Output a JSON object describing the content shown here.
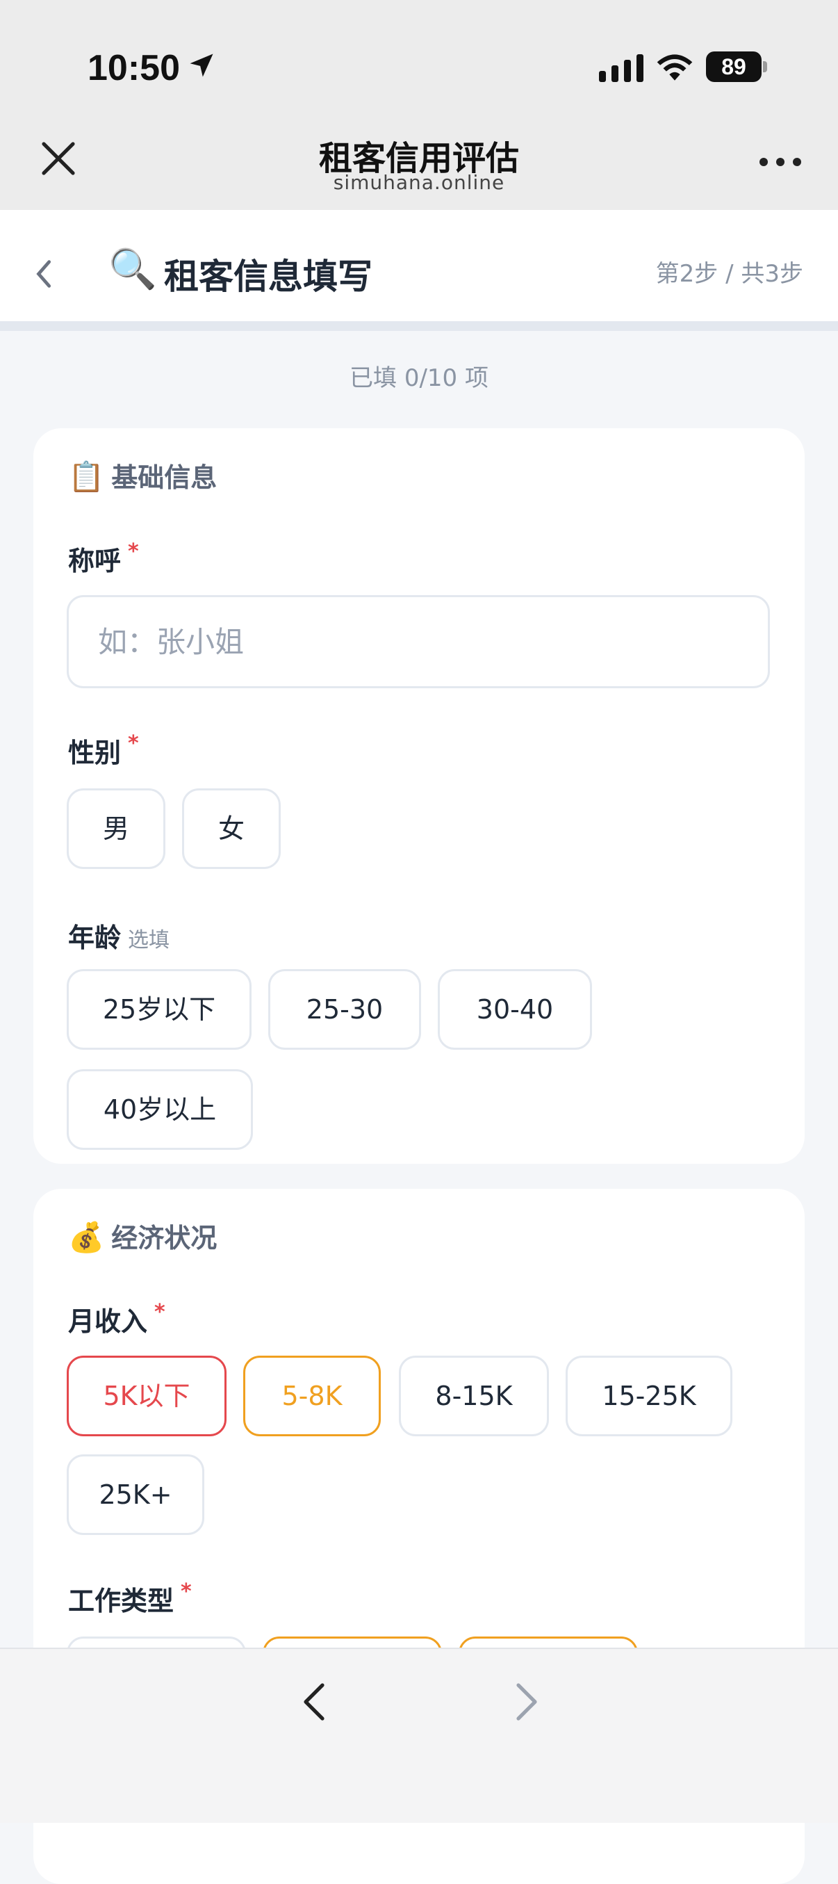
{
  "status_bar": {
    "time": "10:50",
    "battery": "89"
  },
  "nav": {
    "title": "租客信用评估",
    "subtitle": "simuhana.online"
  },
  "header": {
    "emoji": "🔍",
    "title": "租客信息填写",
    "step": "第2步 / 共3步"
  },
  "progress": "已填 0/10 项",
  "basic": {
    "emoji": "📋",
    "title": "基础信息",
    "name_label": "称呼",
    "name_placeholder": "如：张小姐",
    "gender_label": "性别",
    "gender_options": [
      "男",
      "女"
    ],
    "age_label": "年龄",
    "age_optional": "选填",
    "age_options": [
      "25岁以下",
      "25-30",
      "30-40",
      "40岁以上"
    ]
  },
  "economy": {
    "emoji": "💰",
    "title": "经济状况",
    "income_label": "月收入",
    "income_options": [
      "5K以下",
      "5-8K",
      "8-15K",
      "15-25K",
      "25K+"
    ],
    "job_label": "工作类型"
  },
  "required_mark": "*",
  "icons": [
    "close-icon",
    "more-icon",
    "back-icon",
    "location-arrow-icon",
    "signal-icon",
    "wifi-icon",
    "prev-arrow-icon",
    "next-arrow-icon"
  ],
  "colors": {
    "required": "#e5484d",
    "low_income": "#e5484d",
    "mid_income": "#f0a020"
  }
}
